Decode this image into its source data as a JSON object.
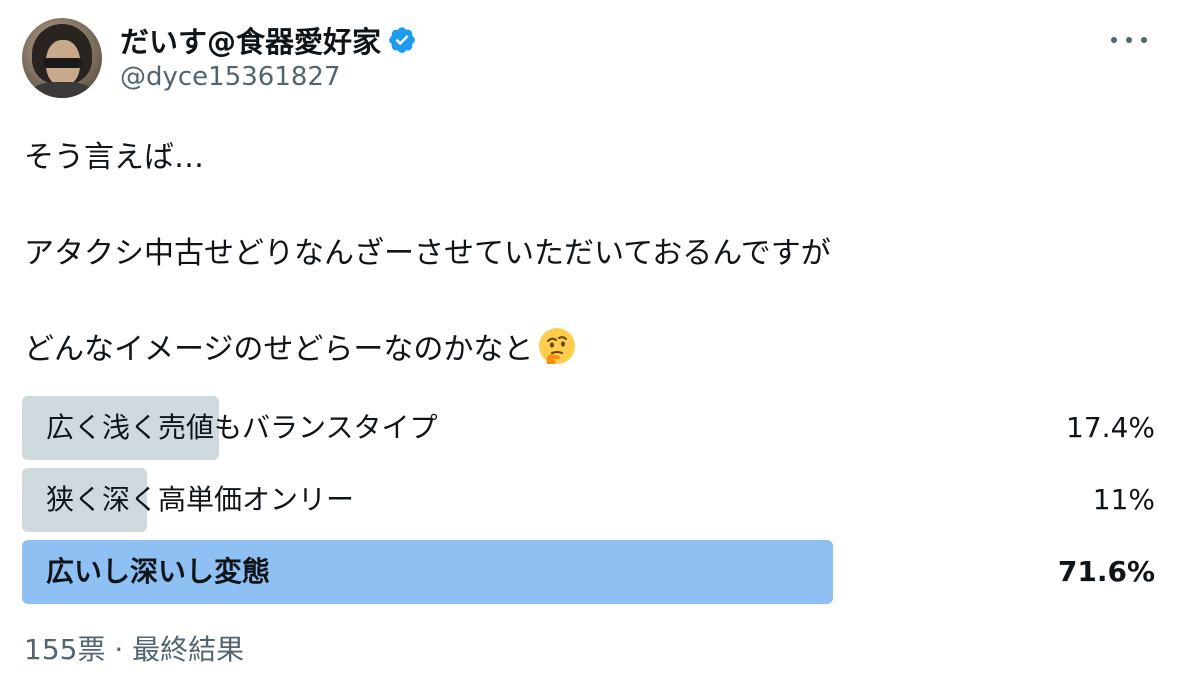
{
  "author": {
    "display_name": "だいす@食器愛好家",
    "handle": "@dyce15361827",
    "verified_icon": "verified-badge-icon",
    "avatar": "profile-photo"
  },
  "tweet": {
    "lines": [
      "そう言えば…",
      "アタクシ中古せどりなんざーさせていただいておるんですが",
      "どんなイメージのせどらーなのかなと"
    ],
    "emoji": "thinking-face-icon"
  },
  "poll": {
    "options": [
      {
        "label": "広く浅く売値もバランスタイプ",
        "percent_text": "17.4%",
        "percent": 17.4,
        "winner": false
      },
      {
        "label": "狭く深く高単価オンリー",
        "percent_text": "11%",
        "percent": 11,
        "winner": false
      },
      {
        "label": "広いし深いし変態",
        "percent_text": "71.6%",
        "percent": 71.6,
        "winner": true
      }
    ],
    "footer": "155票 · 最終結果"
  },
  "colors": {
    "bar_default": "#cfd9de",
    "bar_winner": "#8fc0f3",
    "verified": "#1d9bf0",
    "secondary_text": "#536471"
  }
}
